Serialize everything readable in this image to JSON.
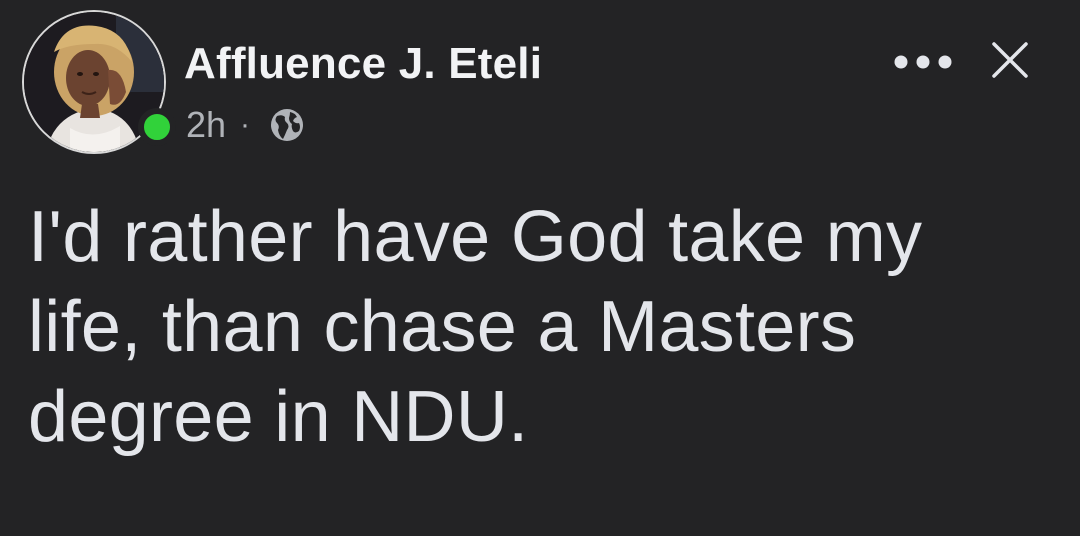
{
  "post": {
    "author_name": "Affluence J. Eteli",
    "timestamp": "2h",
    "separator": "·",
    "audience_icon": "globe-icon",
    "online": true,
    "body": "I'd rather have God take my\nlife, than chase a Masters\ndegree in NDU."
  },
  "actions": {
    "more_icon": "more-horizontal-icon",
    "close_icon": "close-icon"
  },
  "colors": {
    "background": "#232325",
    "text": "#e4e6eb",
    "secondary_text": "#b0b3b8",
    "online_indicator": "#31d23a"
  }
}
